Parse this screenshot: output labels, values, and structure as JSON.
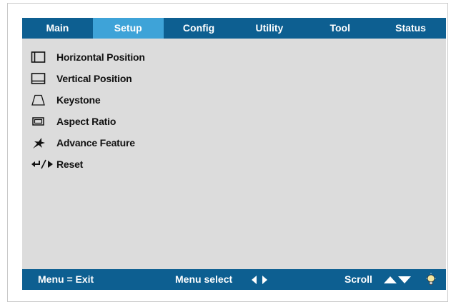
{
  "tabs": [
    {
      "label": "Main"
    },
    {
      "label": "Setup",
      "active": true
    },
    {
      "label": "Config"
    },
    {
      "label": "Utility"
    },
    {
      "label": "Tool"
    },
    {
      "label": "Status"
    }
  ],
  "menu": {
    "items": [
      {
        "label": "Horizontal Position",
        "icon": "horizontal-position-icon"
      },
      {
        "label": "Vertical Position",
        "icon": "vertical-position-icon"
      },
      {
        "label": "Keystone",
        "icon": "keystone-icon"
      },
      {
        "label": "Aspect Ratio",
        "icon": "aspect-ratio-icon"
      },
      {
        "label": "Advance Feature",
        "icon": "advance-feature-icon"
      },
      {
        "label": "Reset",
        "icon": "reset-icon"
      }
    ]
  },
  "statusbar": {
    "exit_text": "Menu = Exit",
    "select_text": "Menu select",
    "scroll_text": "Scroll",
    "left_right_icon": "left-right-arrows-icon",
    "up_down_icon": "up-down-arrows-icon",
    "bulb_icon": "lamp-icon"
  },
  "colors": {
    "bar": "#0d5f91",
    "active_tab": "#3ea3d8",
    "panel": "#dcdcdc"
  }
}
